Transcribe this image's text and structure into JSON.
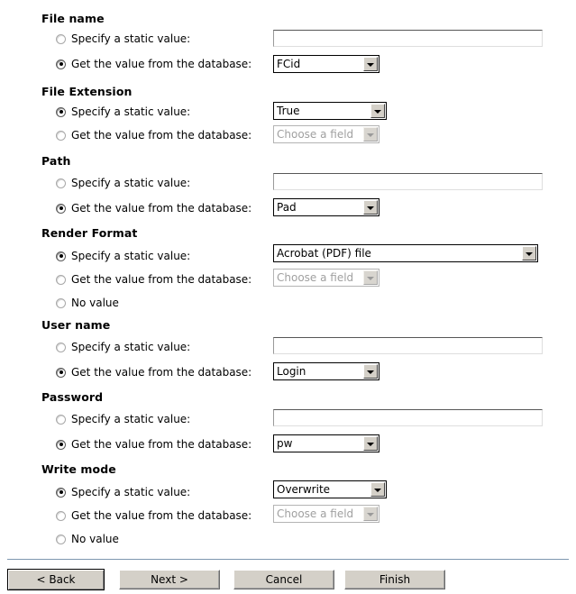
{
  "options": {
    "static_label": "Specify a static value:",
    "database_label": "Get the value from the database:",
    "novalue_label": "No value",
    "placeholder_field": "Choose a field"
  },
  "groups": [
    {
      "id": "file-name",
      "title": "File name",
      "static_selected": false,
      "database_selected": true,
      "static_control": "text",
      "static_value": "",
      "database_value": "FCid",
      "database_disabled": false,
      "has_no_value": false
    },
    {
      "id": "file-extension",
      "title": "File Extension",
      "static_selected": true,
      "database_selected": false,
      "static_control": "select",
      "static_value": "True",
      "database_value": "Choose a field",
      "database_disabled": true,
      "has_no_value": false
    },
    {
      "id": "path",
      "title": "Path",
      "static_selected": false,
      "database_selected": true,
      "static_control": "text",
      "static_value": "",
      "database_value": "Pad",
      "database_disabled": false,
      "has_no_value": false
    },
    {
      "id": "render-format",
      "title": "Render Format",
      "static_selected": true,
      "database_selected": false,
      "static_control": "select-wide",
      "static_value": "Acrobat (PDF) file",
      "database_value": "Choose a field",
      "database_disabled": true,
      "has_no_value": true,
      "no_value_selected": false
    },
    {
      "id": "user-name",
      "title": "User name",
      "static_selected": false,
      "database_selected": true,
      "static_control": "text",
      "static_value": "",
      "database_value": "Login",
      "database_disabled": false,
      "has_no_value": false
    },
    {
      "id": "password",
      "title": "Password",
      "static_selected": false,
      "database_selected": true,
      "static_control": "text",
      "static_value": "",
      "database_value": "pw",
      "database_disabled": false,
      "has_no_value": false
    },
    {
      "id": "write-mode",
      "title": "Write mode",
      "static_selected": true,
      "database_selected": false,
      "static_control": "select",
      "static_value": "Overwrite",
      "database_value": "Choose a field",
      "database_disabled": true,
      "has_no_value": true,
      "no_value_selected": false
    }
  ],
  "footer": {
    "back_label": "< Back",
    "next_label": "Next >",
    "cancel_label": "Cancel",
    "finish_label": "Finish"
  }
}
